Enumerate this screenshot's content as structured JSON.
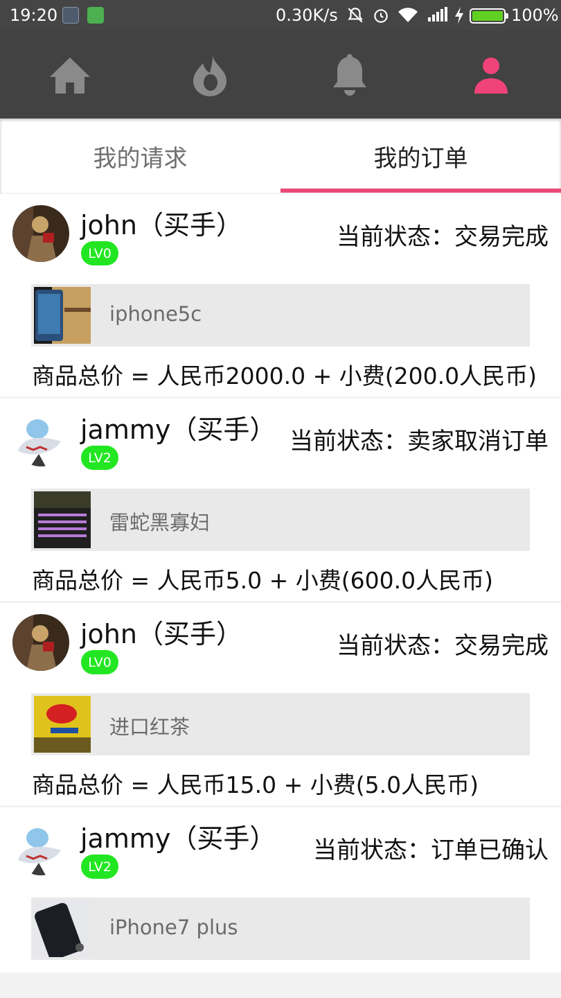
{
  "status_bar": {
    "time": "19:20",
    "net_speed": "0.30K/s",
    "battery_percent": "100%",
    "battery_level": 1.0,
    "icons": [
      "app-icon-1",
      "app-icon-2",
      "mute-icon",
      "alarm-icon",
      "wifi-icon",
      "signal-icon",
      "charging-icon"
    ]
  },
  "nav": {
    "items": [
      {
        "icon": "home-icon",
        "active": false
      },
      {
        "icon": "fire-icon",
        "active": false
      },
      {
        "icon": "bell-icon",
        "active": false
      },
      {
        "icon": "person-icon",
        "active": true
      }
    ],
    "active_color": "#f0437a",
    "inactive_color": "#8a8a8a"
  },
  "tabs": [
    {
      "label": "我的请求",
      "active": false
    },
    {
      "label": "我的订单",
      "active": true
    }
  ],
  "accent_color": "#e84a79",
  "orders": [
    {
      "user": "john（买手）",
      "level": "LV0",
      "status": "当前状态：交易完成",
      "product": "iphone5c",
      "price": "商品总价 = 人民币2000.0 + 小费(200.0人民币)"
    },
    {
      "user": "jammy（买手）",
      "level": "LV2",
      "status": "当前状态：卖家取消订单",
      "product": "雷蛇黑寡妇",
      "price": "商品总价 = 人民币5.0 + 小费(600.0人民币)"
    },
    {
      "user": "john（买手）",
      "level": "LV0",
      "status": "当前状态：交易完成",
      "product": "进口红茶",
      "price": "商品总价 = 人民币15.0 + 小费(5.0人民币)"
    },
    {
      "user": "jammy（买手）",
      "level": "LV2",
      "status": "当前状态：订单已确认",
      "product": "iPhone7 plus",
      "price": ""
    }
  ]
}
